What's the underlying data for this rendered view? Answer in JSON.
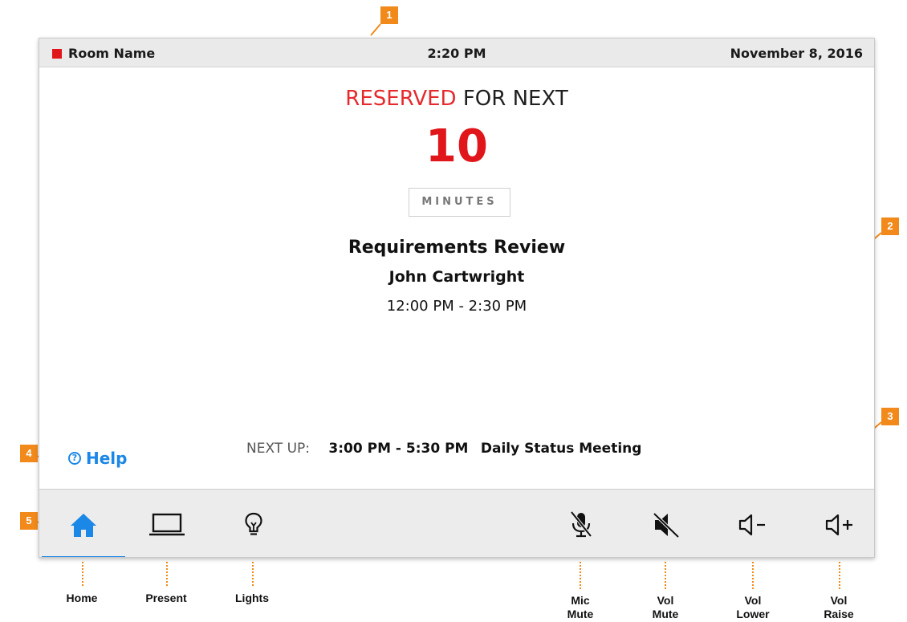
{
  "status_bar": {
    "room_name": "Room Name",
    "time": "2:20 PM",
    "date": "November 8, 2016"
  },
  "reservation": {
    "reserved_word": "RESERVED",
    "rest_text": "FOR NEXT",
    "count": "10",
    "unit": "MINUTES"
  },
  "current_meeting": {
    "title": "Requirements Review",
    "organizer": "John Cartwright",
    "time_range": "12:00 PM - 2:30 PM"
  },
  "next_up": {
    "label": "NEXT UP:",
    "time_range": "3:00 PM - 5:30 PM",
    "title": "Daily Status Meeting"
  },
  "help": {
    "icon_glyph": "?",
    "label": "Help"
  },
  "nav": {
    "active": "home",
    "buttons": [
      {
        "id": "home",
        "icon": "home-icon",
        "label": "Home"
      },
      {
        "id": "present",
        "icon": "laptop-icon",
        "label": "Present"
      },
      {
        "id": "lights",
        "icon": "lightbulb-icon",
        "label": "Lights"
      },
      {
        "id": "mic-mute",
        "icon": "mic-mute-icon",
        "label_line1": "Mic",
        "label_line2": "Mute"
      },
      {
        "id": "vol-mute",
        "icon": "speaker-mute-icon",
        "label_line1": "Vol",
        "label_line2": "Mute"
      },
      {
        "id": "vol-lower",
        "icon": "volume-down-icon",
        "label_line1": "Vol",
        "label_line2": "Lower"
      },
      {
        "id": "vol-raise",
        "icon": "volume-up-icon",
        "label_line1": "Vol",
        "label_line2": "Raise"
      }
    ]
  },
  "callouts": [
    "1",
    "2",
    "3",
    "4",
    "5"
  ],
  "colors": {
    "accent_red": "#e0161b",
    "accent_blue": "#1b87e6",
    "callout_orange": "#f28a1b"
  }
}
